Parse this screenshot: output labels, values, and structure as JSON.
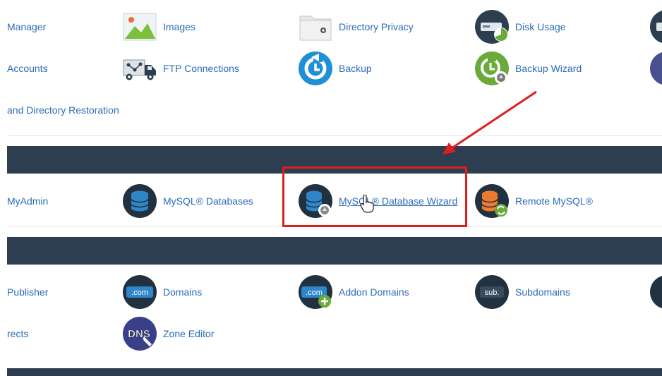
{
  "files_section": {
    "items": [
      {
        "label": "Manager"
      },
      {
        "label": "Images"
      },
      {
        "label": "Directory Privacy"
      },
      {
        "label": "Disk Usage"
      },
      {
        "label": "Accounts"
      },
      {
        "label": "FTP Connections"
      },
      {
        "label": "Backup"
      },
      {
        "label": "Backup Wizard"
      },
      {
        "label": "and Directory Restoration"
      }
    ]
  },
  "databases_section": {
    "items": [
      {
        "label": "MyAdmin"
      },
      {
        "label": "MySQL® Databases"
      },
      {
        "label": "MySQL® Database Wizard"
      },
      {
        "label": "Remote MySQL®"
      }
    ]
  },
  "domains_section": {
    "items": [
      {
        "label": "Publisher"
      },
      {
        "label": "Domains"
      },
      {
        "label": "Addon Domains"
      },
      {
        "label": "Subdomains"
      },
      {
        "label": "rects"
      },
      {
        "label": "Zone Editor"
      }
    ],
    "icon_text": {
      "com": ".com",
      "sub": "sub.",
      "dns": "DNS"
    }
  },
  "colors": {
    "header_bar": "#2c3e50",
    "link": "#2b6cb8",
    "highlight": "#e01e1e"
  },
  "icons": [
    "images-icon",
    "directory-privacy-icon",
    "disk-usage-icon",
    "ftp-connections-icon",
    "backup-icon",
    "backup-wizard-icon",
    "mysql-databases-icon",
    "mysql-database-wizard-icon",
    "remote-mysql-icon",
    "domains-icon",
    "addon-domains-icon",
    "subdomains-icon",
    "zone-editor-icon",
    "hand-cursor-icon"
  ]
}
